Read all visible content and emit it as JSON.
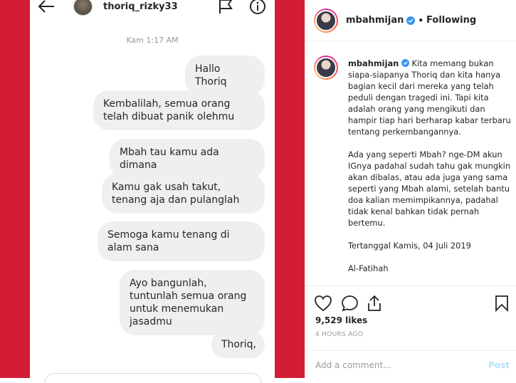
{
  "dm": {
    "username": "thoriq_rizky33",
    "timestamp": "Kam 1:17 AM",
    "messages": [
      "Hallo Thoriq",
      "Kembalilah, semua orang telah dibuat panik olehmu",
      "Mbah tau kamu ada dimana",
      "Kamu gak usah takut, tenang aja dan pulanglah",
      "Semoga kamu tenang di alam sana",
      "Ayo bangunlah, tuntunlah semua orang untuk menemukan jasadmu",
      "Thoriq,"
    ]
  },
  "post": {
    "username": "mbahmijan",
    "separator": "•",
    "follow_status": "Following",
    "caption_user": "mbahmijan",
    "caption_p1": "Kita memang bukan siapa-siapanya Thoriq dan kita hanya bagian kecil dari mereka yang telah peduli dengan tragedi ini. Tapi kita adalah orang yang mengikuti dan hampir tiap hari berharap kabar terbaru tentang perkembangannya.",
    "caption_p2": "Ada yang seperti Mbah? nge-DM akun IGnya padahal sudah tahu gak mungkin akan dibalas, atau ada juga yang sama seperti yang Mbah alami, setelah bantu doa kalian memimpikannya, padahal tidak kenal bahkan tidak pernah bertemu.",
    "caption_p3": "Tertanggal Kamis, 04 Juli 2019",
    "caption_p4": "Al-Fatihah",
    "likes": "9,529 likes",
    "time_ago": "4 HOURS AGO",
    "comment_placeholder": "Add a comment...",
    "post_label": "Post"
  },
  "colors": {
    "background_red": "#d21d34",
    "verified_blue": "#3897f0",
    "post_disabled": "#b2dffc"
  }
}
